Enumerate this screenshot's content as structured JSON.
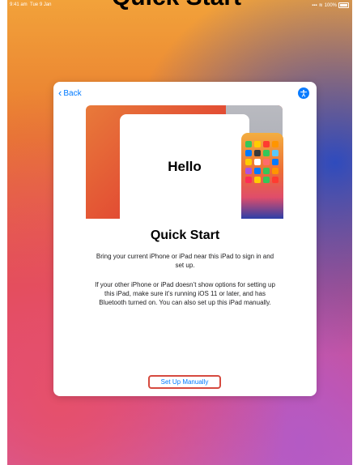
{
  "page_heading": "Quick Start",
  "status_bar": {
    "time": "9:41 am",
    "date": "Tue 9 Jan",
    "signal": "▪▪▪",
    "wifi": "≋",
    "battery": "100%"
  },
  "navigation": {
    "back_label": "Back",
    "back_icon": "chevron-left-icon",
    "accessibility_icon": "accessibility-icon"
  },
  "hero": {
    "hello_text": "Hello",
    "app_icon_colors": [
      "#34c759",
      "#ffcc00",
      "#ff3b30",
      "#ff9500",
      "#007aff",
      "#3a3a3c",
      "#34c759",
      "#5ac8fa",
      "#ffcc00",
      "#ffffff",
      "#ff6b6b",
      "#007aff",
      "#af52de",
      "#007aff",
      "#34c759",
      "#ff9500",
      "#ff2d55",
      "#ffcc00",
      "#34c759",
      "#ff3b30"
    ]
  },
  "content": {
    "title": "Quick Start",
    "paragraph1": "Bring your current iPhone or iPad near this iPad to sign in and set up.",
    "paragraph2": "If your other iPhone or iPad doesn’t show options for setting up this iPad, make sure it’s running iOS 11 or later, and has Bluetooth turned on. You can also set up this iPad manually."
  },
  "actions": {
    "manual_setup_label": "Set Up Manually"
  },
  "colors": {
    "accent": "#007aff",
    "highlight_border": "#d64a3f"
  }
}
